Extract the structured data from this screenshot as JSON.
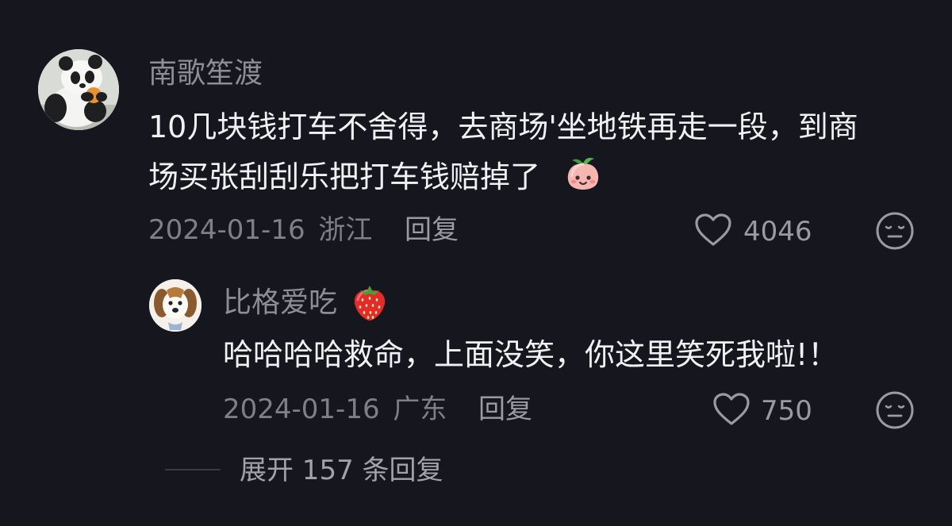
{
  "comment": {
    "username": "南歌笙渡",
    "text_line1": "10几块钱打车不舍得，去商场'坐地铁再走一段，到商",
    "text_line2": "场买张刮刮乐把打车钱赔掉了",
    "date": "2024-01-16",
    "location": "浙江",
    "reply_label": "回复",
    "like_count": "4046",
    "emoji_name": "peach-smile-emoji-icon"
  },
  "reply": {
    "username": "比格爱吃",
    "username_emoji": "strawberry-icon",
    "text": "哈哈哈哈救命，上面没笑，你这里笑死我啦!！",
    "date": "2024-01-16",
    "location": "广东",
    "reply_label": "回复",
    "like_count": "750"
  },
  "expand": {
    "label": "展开 157 条回复"
  },
  "colors": {
    "background": "#16161e",
    "text_primary": "#f1f1f3",
    "text_secondary": "#8d8d95"
  }
}
